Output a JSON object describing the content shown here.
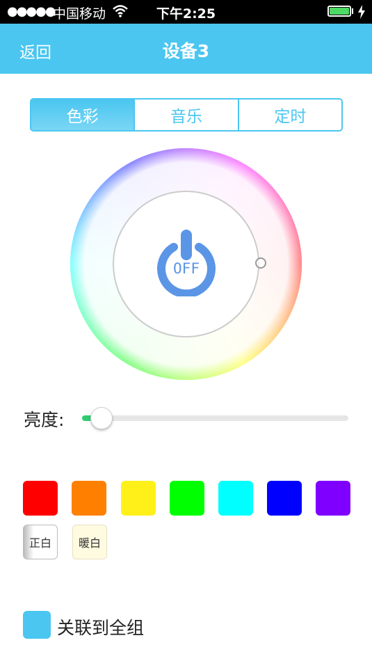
{
  "status_bar": {
    "signal_dots": "●●●●●",
    "carrier": "中国移动",
    "time": "下午2:25",
    "battery_color": "#4cd964"
  },
  "nav": {
    "back_label": "返回",
    "title": "设备3",
    "background": "#4ac6f0"
  },
  "tabs": [
    {
      "label": "色彩",
      "active": true
    },
    {
      "label": "音乐",
      "active": false
    },
    {
      "label": "定时",
      "active": false
    }
  ],
  "color_wheel": {
    "power_label": "OFF",
    "power_color": "#5b95e6"
  },
  "brightness": {
    "label": "亮度:",
    "value": 0.07
  },
  "swatches": [
    {
      "name": "red",
      "color": "#ff0000"
    },
    {
      "name": "orange",
      "color": "#ff8000"
    },
    {
      "name": "yellow",
      "color": "#fff01a"
    },
    {
      "name": "green",
      "color": "#00ff00"
    },
    {
      "name": "cyan",
      "color": "#00ffff"
    },
    {
      "name": "blue",
      "color": "#0000ff"
    },
    {
      "name": "violet",
      "color": "#8000ff"
    }
  ],
  "white_buttons": {
    "pure": "正白",
    "warm": "暖白"
  },
  "group_link": {
    "label": "关联到全组",
    "checked": true
  }
}
